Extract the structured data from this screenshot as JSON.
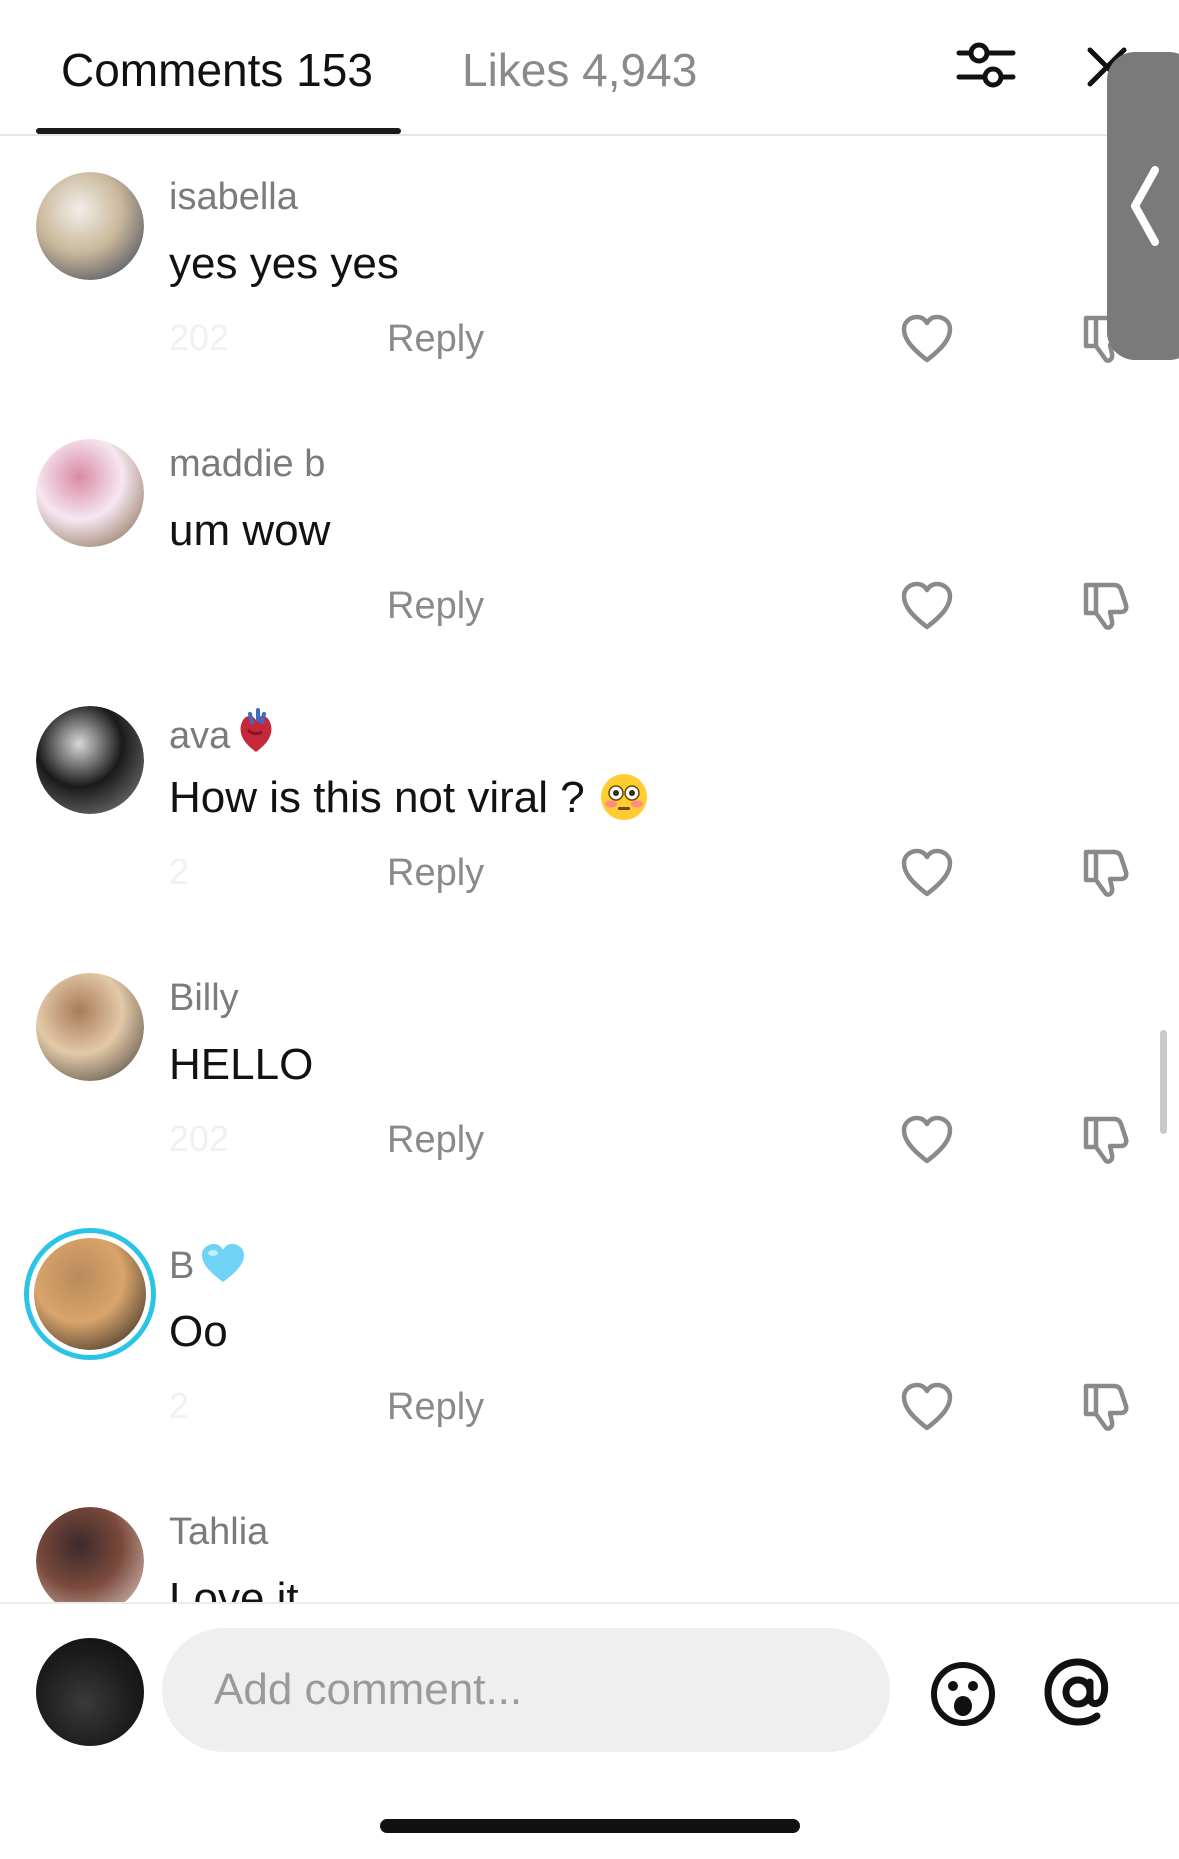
{
  "header": {
    "comments_tab": "Comments 153",
    "likes_tab": "Likes 4,943"
  },
  "comments": [
    {
      "username": "isabella",
      "badge": "",
      "text": "yes yes yes",
      "text_emoji": "",
      "date": "202",
      "reply_label": "Reply",
      "avatar": {
        "colors": [
          "#c9b79a",
          "#2c3550",
          "#f1efe9"
        ],
        "ring": false
      }
    },
    {
      "username": "maddie b",
      "badge": "",
      "text": "um wow",
      "text_emoji": "",
      "date": "",
      "reply_label": "Reply",
      "avatar": {
        "colors": [
          "#f6e7f1",
          "#7a5a3a",
          "#d98aa4"
        ],
        "ring": false
      }
    },
    {
      "username": "ava",
      "badge": "anatomical-heart-emoji",
      "text": "How is this not viral ?",
      "text_emoji": "flushed-face-emoji",
      "date": "2",
      "reply_label": "Reply",
      "avatar": {
        "colors": [
          "#1a1a1a",
          "#8c8c8c",
          "#d8d8d8"
        ],
        "ring": false
      }
    },
    {
      "username": "Billy",
      "badge": "",
      "text": "HELLO",
      "text_emoji": "",
      "date": "202",
      "reply_label": "Reply",
      "avatar": {
        "colors": [
          "#e3c9a8",
          "#3a3530",
          "#a87b56"
        ],
        "ring": false
      }
    },
    {
      "username": "B",
      "badge": "light-blue-heart-emoji",
      "text": "Oo",
      "text_emoji": "",
      "date": "2",
      "reply_label": "Reply",
      "avatar": {
        "colors": [
          "#d9a46b",
          "#1b1b1b",
          "#b98a5c"
        ],
        "ring": true
      }
    },
    {
      "username": "Tahlia",
      "badge": "",
      "text": "Love it",
      "text_emoji": "",
      "date": "",
      "reply_label": "Reply",
      "avatar": {
        "colors": [
          "#7a4a3c",
          "#e8d4cf",
          "#3c2a2a"
        ],
        "ring": false
      }
    }
  ],
  "composer": {
    "placeholder": "Add comment..."
  },
  "icons": {
    "filter": "sliders-icon",
    "close": "close-icon",
    "side_tab": "chevron-left-icon",
    "like": "heart-outline-icon",
    "dislike": "thumbs-down-outline-icon",
    "emoji": "smiley-icon",
    "mention": "at-sign-icon"
  },
  "colors": {
    "text_primary": "#121212",
    "text_secondary": "#8a8a8a",
    "story_ring": "#2cc4e6",
    "input_background": "#efefef"
  }
}
